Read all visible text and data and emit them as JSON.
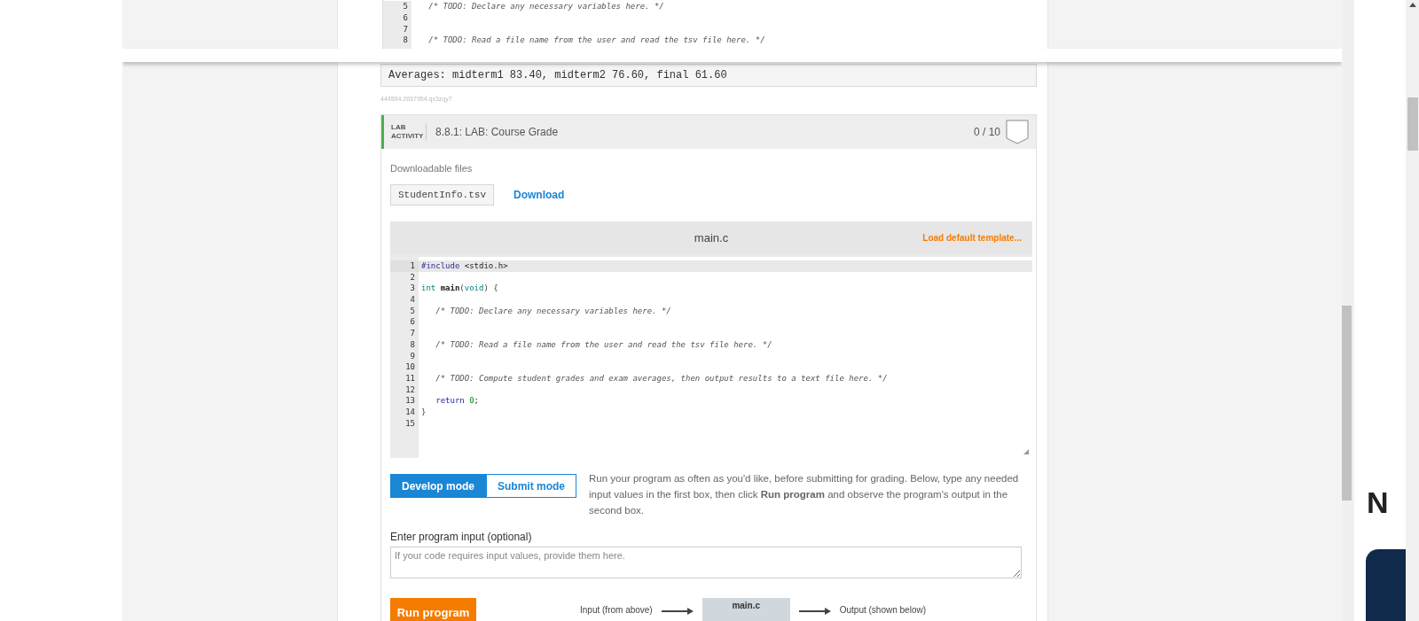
{
  "top_editor": {
    "lines": [
      {
        "number": "5",
        "tokens": [
          {
            "text": "   /* TODO: Declare any necessary variables here. */",
            "kind": "comment"
          }
        ]
      },
      {
        "number": "6"
      },
      {
        "number": "7"
      },
      {
        "number": "8",
        "tokens": [
          {
            "text": "   /* TODO: Read a file name from the user and read the tsv file here. */",
            "kind": "comment"
          }
        ]
      }
    ]
  },
  "output": {
    "text": "Averages: midterm1 83.40, midterm2 76.60, final 61.60"
  },
  "content_id": "444594.2637954.qx3zqy7",
  "lab": {
    "tag": "LAB ACTIVITY",
    "title": "8.8.1: LAB: Course Grade",
    "score": "0 / 10",
    "files": {
      "heading": "Downloadable files",
      "items": [
        {
          "name": "StudentInfo.tsv"
        }
      ],
      "download": "Download"
    },
    "editor": {
      "filename": "main.c",
      "template_link": "Load default template...",
      "lines": [
        {
          "number": "1",
          "tokens": [
            {
              "text": "#include",
              "kind": "directive"
            },
            {
              "text": " <stdio.h>",
              "kind": "plain"
            }
          ]
        },
        {
          "number": "2"
        },
        {
          "number": "3",
          "tokens": [
            {
              "text": "int",
              "kind": "type"
            },
            {
              "text": " main",
              "kind": "name"
            },
            {
              "text": "(",
              "kind": "punct"
            },
            {
              "text": "void",
              "kind": "type"
            },
            {
              "text": ") {",
              "kind": "punct"
            }
          ]
        },
        {
          "number": "4"
        },
        {
          "number": "5",
          "tokens": [
            {
              "text": "   /* TODO: Declare any necessary variables here. */",
              "kind": "comment"
            }
          ]
        },
        {
          "number": "6"
        },
        {
          "number": "7"
        },
        {
          "number": "8",
          "tokens": [
            {
              "text": "   /* TODO: Read a file name from the user and read the tsv file here. */",
              "kind": "comment"
            }
          ]
        },
        {
          "number": "9"
        },
        {
          "number": "10"
        },
        {
          "number": "11",
          "tokens": [
            {
              "text": "   /* TODO: Compute student grades and exam averages, then output results to a text file here. */",
              "kind": "comment"
            }
          ]
        },
        {
          "number": "12"
        },
        {
          "number": "13",
          "tokens": [
            {
              "text": "   return ",
              "kind": "keyword"
            },
            {
              "text": "0",
              "kind": "number"
            },
            {
              "text": ";",
              "kind": "plain"
            }
          ]
        },
        {
          "number": "14",
          "tokens": [
            {
              "text": "}",
              "kind": "punct"
            }
          ]
        },
        {
          "number": "15"
        }
      ]
    },
    "modes": [
      {
        "label": "Develop mode",
        "selected": true
      },
      {
        "label": "Submit mode",
        "selected": false
      }
    ],
    "instructions": "Run your program as often as you'd like, before submitting for grading. Below, type any needed input values in the first box, then click **Run program** and observe the program's output in the second box.",
    "input": {
      "label": "Enter program input (optional)",
      "placeholder": "If your code requires input values, provide them here."
    },
    "run": {
      "button": "Run program",
      "input_label": "Input (from above)",
      "file": "main.c",
      "output_label": "Output (shown below)"
    }
  },
  "side_panel": {
    "heading": "N"
  }
}
